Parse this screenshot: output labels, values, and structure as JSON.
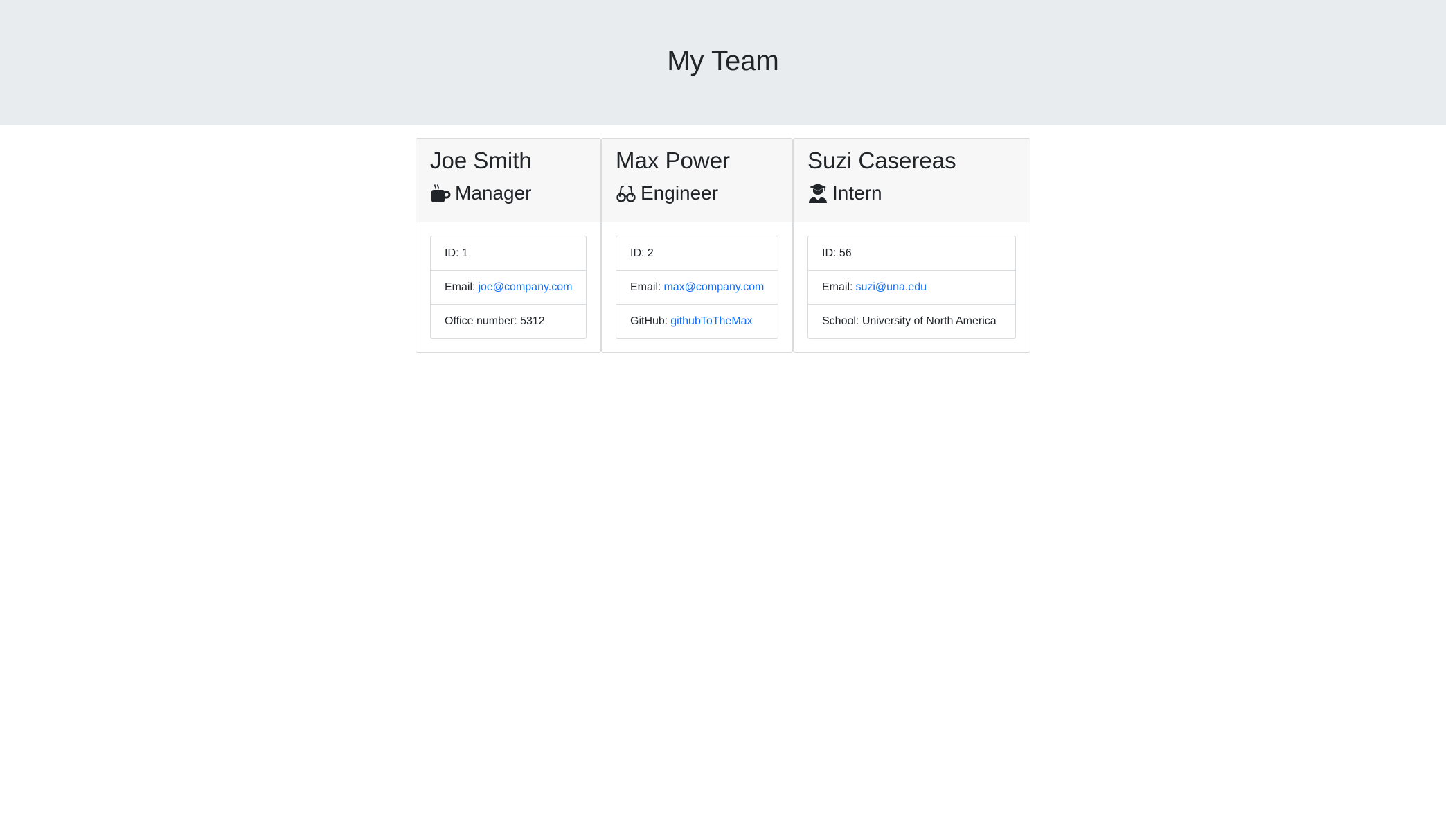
{
  "header": {
    "title": "My Team"
  },
  "team": [
    {
      "name": "Joe Smith",
      "role": "Manager",
      "icon": "coffee-mug-icon",
      "id_label": "ID:",
      "id": "1",
      "email_label": "Email:",
      "email": "joe@company.com",
      "extra_label": "Office number:",
      "extra_value": "5312"
    },
    {
      "name": "Max Power",
      "role": "Engineer",
      "icon": "glasses-icon",
      "id_label": "ID:",
      "id": "2",
      "email_label": "Email:",
      "email": "max@company.com",
      "extra_label": "GitHub:",
      "extra_value": "githubToTheMax"
    },
    {
      "name": "Suzi Casereas",
      "role": "Intern",
      "icon": "graduate-icon",
      "id_label": "ID:",
      "id": "56",
      "email_label": "Email:",
      "email": "suzi@una.edu",
      "extra_label": "School:",
      "extra_value": "University of North America"
    }
  ],
  "colors": {
    "header_bg": "#e9ecef",
    "link": "#0d6efd",
    "card_header_bg": "#f7f7f7",
    "border": "#d9dcdf"
  }
}
